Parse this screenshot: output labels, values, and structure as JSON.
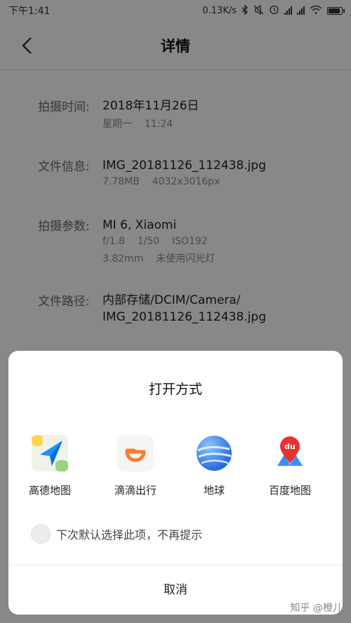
{
  "status_bar": {
    "time": "下午1:41",
    "speed": "0.13K/s",
    "bluetooth_icon": "bluetooth-icon",
    "mute_icon": "mute-icon",
    "alarm_icon": "alarm-icon",
    "wifi_icon": "wifi-icon",
    "battery_icon": "battery-icon"
  },
  "header": {
    "title": "详情",
    "back_icon": "back-arrow-icon"
  },
  "details": [
    {
      "label": "拍摄时间:",
      "value": "2018年11月26日",
      "sub": [
        "星期一    11:24"
      ]
    },
    {
      "label": "文件信息:",
      "value": "IMG_20181126_112438.jpg",
      "sub": [
        "7.78MB    4032x3016px"
      ]
    },
    {
      "label": "拍摄参数:",
      "value": "MI 6, Xiaomi",
      "sub": [
        "f/1.8    1/50    ISO192",
        "3.82mm    未使用闪光灯"
      ]
    },
    {
      "label": "文件路径:",
      "value": "内部存储/DCIM/Camera/",
      "value2": "IMG_20181126_112438.jpg"
    }
  ],
  "dialog": {
    "title": "打开方式",
    "apps": [
      {
        "name": "高德地图",
        "icon": "amap-icon"
      },
      {
        "name": "滴滴出行",
        "icon": "didi-icon"
      },
      {
        "name": "地球",
        "icon": "google-earth-icon"
      },
      {
        "name": "百度地图",
        "icon": "baidu-map-icon"
      }
    ],
    "default_option": "下次默认选择此项，不再提示",
    "cancel_label": "取消",
    "baidu_badge": "du"
  },
  "watermark": "知乎 @橙儿",
  "colors": {
    "amap_blue": "#1e8fff",
    "didi_orange": "#ff7a2f",
    "earth_blue": "#2f7fe6",
    "baidu_red": "#e8322e"
  }
}
